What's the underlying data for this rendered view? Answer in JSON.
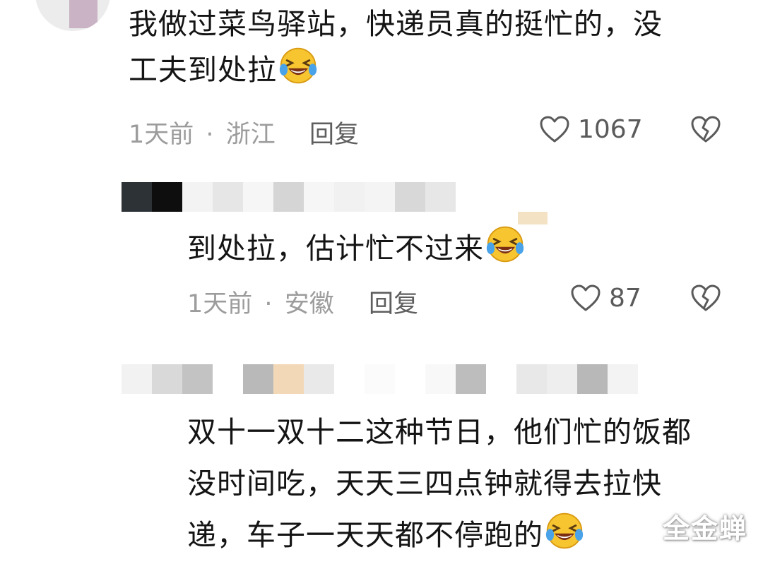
{
  "comments": [
    {
      "text_lines": [
        "我做过菜鸟驿站，快递员真的挺忙的，没",
        "工夫到处拉"
      ],
      "emoji": "grinning-squinting-tears-emoji",
      "time": "1天前",
      "separator": "·",
      "location": "浙江",
      "reply_label": "回复",
      "like_count": "1067"
    },
    {
      "text_lines": [
        "到处拉，估计忙不过来"
      ],
      "emoji": "grinning-squinting-tears-emoji",
      "time": "1天前",
      "separator": "·",
      "location": "安徽",
      "reply_label": "回复",
      "like_count": "87"
    },
    {
      "text_lines": [
        "双十一双十二这种节日，他们忙的饭都",
        "没时间吃，天天三四点钟就得去拉快",
        "递，车子一天天都不停跑的"
      ],
      "emoji": "grinning-squinting-tears-emoji"
    }
  ],
  "icons": {
    "like": "heart-outline-icon",
    "dislike": "broken-heart-icon"
  },
  "watermark": "全金蝉",
  "colors": {
    "text": "#141414",
    "meta": "#9c9c9c",
    "reply": "#5e5e5e",
    "emoji_yellow": "#f7c530",
    "emoji_tear": "#4aa3e8"
  }
}
